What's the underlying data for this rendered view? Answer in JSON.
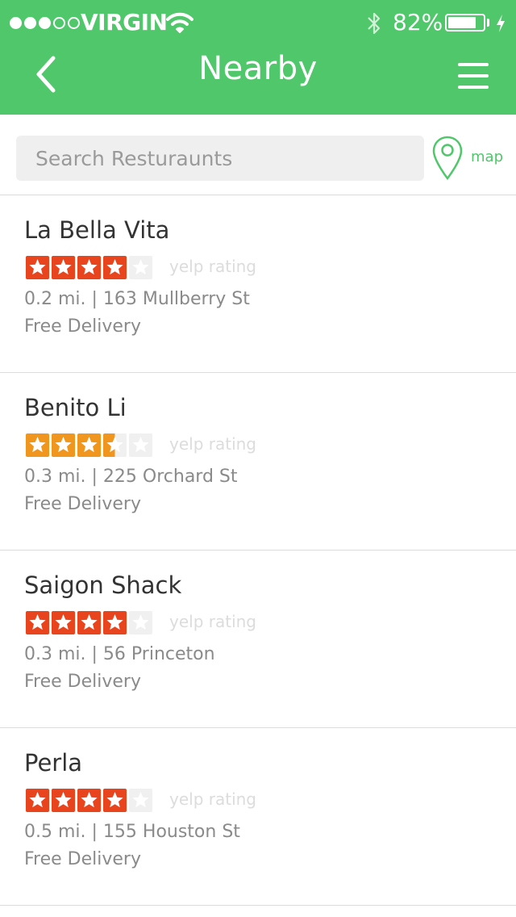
{
  "status_bar": {
    "carrier": "VIRGIN",
    "battery_percent": "82%",
    "battery_level": 0.82,
    "signal_bars_filled": 3,
    "signal_bars_total": 5
  },
  "nav": {
    "title": "Nearby",
    "back_icon": "chevron-left-icon",
    "menu_icon": "hamburger-menu-icon"
  },
  "search": {
    "placeholder": "Search Resturaunts",
    "value": ""
  },
  "map_button": {
    "label": "map",
    "icon": "map-pin-icon"
  },
  "colors": {
    "brand_green": "#4fc76a",
    "star_red": "#e8451e",
    "star_orange": "#f0961e",
    "star_empty": "#f0f0f0"
  },
  "restaurants": [
    {
      "name": "La Bella Vita",
      "rating": 4,
      "rating_label": "yelp rating",
      "star_color": "#e8451e",
      "address": "0.2 mi. | 163 Mullberry St",
      "delivery": "Free Delivery"
    },
    {
      "name": "Benito Li",
      "rating": 3.5,
      "rating_label": "yelp rating",
      "star_color": "#f0961e",
      "address": "0.3 mi. | 225 Orchard St",
      "delivery": "Free Delivery"
    },
    {
      "name": "Saigon Shack",
      "rating": 4,
      "rating_label": "yelp rating",
      "star_color": "#e8451e",
      "address": "0.3 mi. | 56 Princeton",
      "delivery": "Free Delivery"
    },
    {
      "name": "Perla",
      "rating": 4,
      "rating_label": "yelp rating",
      "star_color": "#e8451e",
      "address": "0.5 mi. | 155 Houston St",
      "delivery": "Free Delivery"
    }
  ]
}
